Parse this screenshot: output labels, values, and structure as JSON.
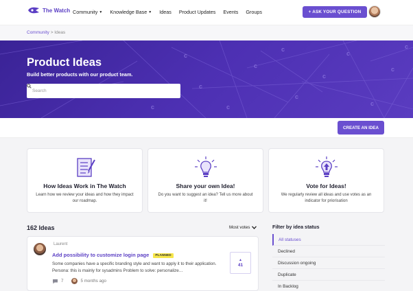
{
  "nav": {
    "logo_text": "The Watch",
    "links": [
      {
        "label": "Community",
        "dropdown": true
      },
      {
        "label": "Knowledge Base",
        "dropdown": true
      },
      {
        "label": "Ideas",
        "dropdown": false
      },
      {
        "label": "Product Updates",
        "dropdown": false
      },
      {
        "label": "Events",
        "dropdown": false
      },
      {
        "label": "Groups",
        "dropdown": false
      }
    ],
    "ask_button": "+ ASK YOUR QUESTION",
    "accent_color": "#6a4fd0"
  },
  "breadcrumb": {
    "root": "Community",
    "separator": ">",
    "current": "Ideas"
  },
  "hero": {
    "title": "Product Ideas",
    "subtitle": "Build better products with our product team.",
    "search_placeholder": "Search"
  },
  "create_button": "CREATE AN IDEA",
  "cards": [
    {
      "icon": "checklist-icon",
      "title": "How Ideas Work in The Watch",
      "desc": "Learn how we review your ideas and how they impact our roadmap."
    },
    {
      "icon": "lightbulb-icon",
      "title": "Share your own Idea!",
      "desc": "Do you want to suggest an idea? Tell us more about it!"
    },
    {
      "icon": "lightbulb-upvote-icon",
      "title": "Vote for Ideas!",
      "desc": "We regularly review all ideas and use votes as an indicator for priorisation"
    }
  ],
  "list": {
    "count_label": "162 Ideas",
    "sort_label": "Most votes"
  },
  "idea": {
    "author": "Laurent",
    "title": "Add possibility to customize login page",
    "status": "PLANNED",
    "status_color": "#f6e64b",
    "body": "Some companies have a specific branding style and want to apply it to their application. Persona: this is mainly for sysadmins Problem to solve: personalize…",
    "comments": "7",
    "time": "5 months ago",
    "votes": "41"
  },
  "filter": {
    "title": "Filter by idea status",
    "items": [
      "All statuses",
      "Declined",
      "Discussion ongoing",
      "Duplicate",
      "In Backlog"
    ],
    "active_index": 0
  }
}
